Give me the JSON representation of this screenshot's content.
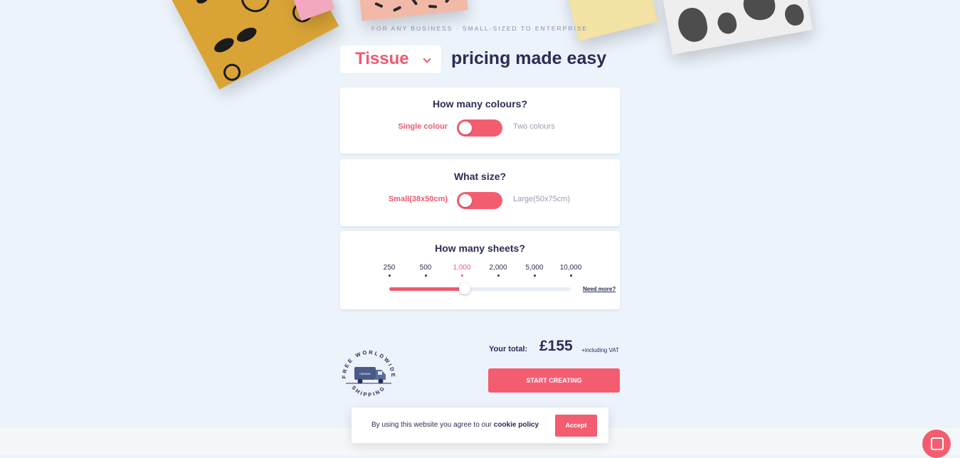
{
  "kicker": "FOR ANY BUSINESS · SMALL-SIZED TO ENTERPRISE",
  "product_select": {
    "value": "Tissue",
    "icon": "chevron-down-icon"
  },
  "headline": "pricing made easy",
  "colours": {
    "title": "How many colours?",
    "left_label": "Single colour",
    "right_label": "Two colours",
    "selected": "Single colour"
  },
  "size": {
    "title": "What size?",
    "left_label": "Small(38x50cm)",
    "right_label": "Large(50x75cm)",
    "selected": "Small(38x50cm)"
  },
  "sheets": {
    "title": "How many sheets?",
    "options": [
      "250",
      "500",
      "1,000",
      "2,000",
      "5,000",
      "10,000"
    ],
    "selected": "1,000",
    "need_more": "Need more?"
  },
  "shipping_stamp": {
    "top_text": "FREE WORLDWIDE",
    "bottom_text": "SHIPPING",
    "truck_text": "noissue",
    "icon": "truck-icon"
  },
  "total": {
    "label": "Your total:",
    "value": "£155",
    "vat_note": "+including VAT"
  },
  "cta_label": "START CREATING",
  "cookie": {
    "text": "By using this website you agree to our",
    "link": "cookie policy",
    "accept": "Accept"
  },
  "chat": {
    "icon": "chat-icon"
  },
  "colors": {
    "accent": "#f45d70",
    "navy": "#2b2d55",
    "background": "#ecf3fb"
  }
}
